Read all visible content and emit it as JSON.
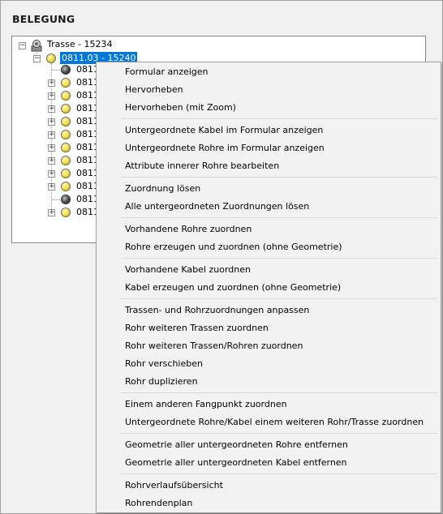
{
  "panel": {
    "title": "BELEGUNG"
  },
  "tree": {
    "root": {
      "label": "Trasse - 15234"
    },
    "selected": {
      "label": "0811.03 - 15240"
    },
    "children": [
      {
        "label": "0811",
        "icon": "dark-circle-icon"
      },
      {
        "label": "0811",
        "icon": "yellow-circle-icon"
      },
      {
        "label": "0811",
        "icon": "yellow-circle-icon"
      },
      {
        "label": "0811",
        "icon": "yellow-circle-icon"
      },
      {
        "label": "0811",
        "icon": "yellow-circle-icon"
      },
      {
        "label": "0811",
        "icon": "yellow-circle-icon"
      },
      {
        "label": "0811",
        "icon": "yellow-circle-icon"
      },
      {
        "label": "0811",
        "icon": "yellow-circle-icon"
      },
      {
        "label": "0811",
        "icon": "yellow-circle-icon"
      },
      {
        "label": "0811",
        "icon": "yellow-circle-icon"
      },
      {
        "label": "0811",
        "icon": "dark-circle-icon"
      },
      {
        "label": "0811",
        "icon": "yellow-circle-icon"
      }
    ]
  },
  "menu": {
    "items": [
      "Formular anzeigen",
      "Hervorheben",
      "Hervorheben (mit Zoom)",
      "Untergeordnete Kabel im Formular anzeigen",
      "Untergeordnete Rohre im Formular anzeigen",
      "Attribute innerer Rohre bearbeiten",
      "Zuordnung lösen",
      "Alle untergeordneten Zuordnungen lösen",
      "Vorhandene Rohre zuordnen",
      "Rohre erzeugen und zuordnen (ohne Geometrie)",
      "Vorhandene Kabel zuordnen",
      "Kabel erzeugen und zuordnen (ohne Geometrie)",
      "Trassen- und Rohrzuordnungen anpassen",
      "Rohr weiteren Trassen zuordnen",
      "Rohr weiteren Trassen/Rohren zuordnen",
      "Rohr verschieben",
      "Rohr duplizieren",
      "Einem anderen Fangpunkt zuordnen",
      "Untergeordnete Rohre/Kabel einem weiteren Rohr/Trasse zuordnen",
      "Geometrie aller untergeordneten Rohre entfernen",
      "Geometrie aller untergeordneten Kabel entfernen",
      "Rohrverlaufsübersicht",
      "Rohrendenplan"
    ]
  },
  "colors": {
    "selection": "#0078d7",
    "menu_bg": "#f2f2f2"
  }
}
